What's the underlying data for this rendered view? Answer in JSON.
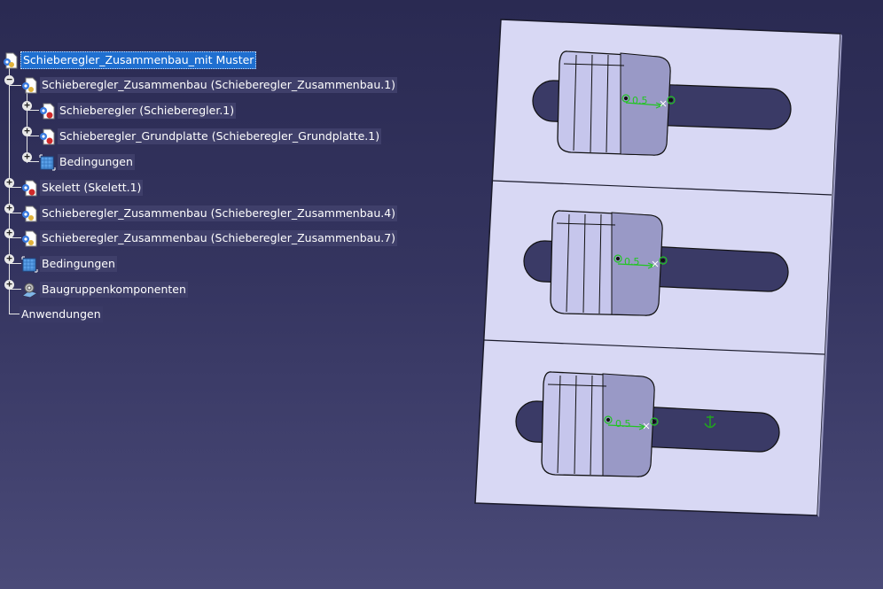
{
  "tree": {
    "root": "Schieberegler_Zusammenbau_mit Muster",
    "n1": "Schieberegler_Zusammenbau (Schieberegler_Zusammenbau.1)",
    "n1a": "Schieberegler (Schieberegler.1)",
    "n1b": "Schieberegler_Grundplatte (Schieberegler_Grundplatte.1)",
    "n1c": "Bedingungen",
    "n2": "Skelett (Skelett.1)",
    "n3": "Schieberegler_Zusammenbau (Schieberegler_Zusammenbau.4)",
    "n4": "Schieberegler_Zusammenbau (Schieberegler_Zusammenbau.7)",
    "n5": "Bedingungen",
    "n6": "Baugruppenkomponenten",
    "n7": "Anwendungen"
  },
  "model": {
    "constraint_label": "0.5",
    "slot_count": 3
  },
  "colors": {
    "selection": "#1f6fd0",
    "constraint_green": "#22c522",
    "plate": "#d8d8f4",
    "knob": "#c4c4ea"
  }
}
